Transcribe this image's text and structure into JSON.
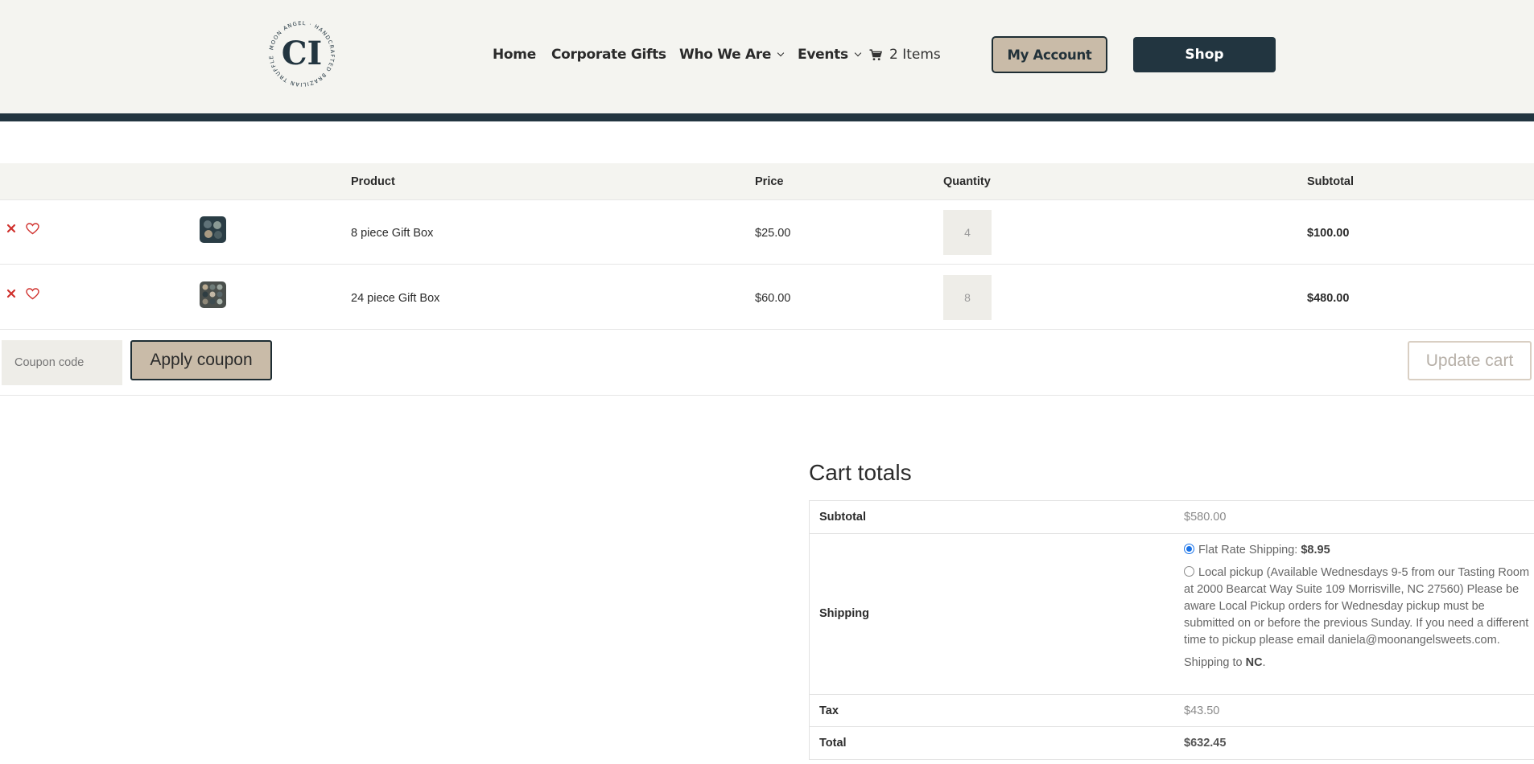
{
  "header": {
    "logo_text": "MOON ANGEL · HANDCRAFTED BRAZILIAN TRUFFLES ·",
    "logo_monogram": "CI",
    "nav": [
      {
        "label": "Home"
      },
      {
        "label": "Corporate Gifts"
      },
      {
        "label": "Who We Are",
        "dropdown": true
      },
      {
        "label": "Events",
        "dropdown": true
      }
    ],
    "cart_label": "2 Items",
    "account_label": "My Account",
    "shop_label": "Shop"
  },
  "cart": {
    "columns": {
      "product": "Product",
      "price": "Price",
      "quantity": "Quantity",
      "subtotal": "Subtotal"
    },
    "items": [
      {
        "name": "8 piece Gift Box",
        "price": "$25.00",
        "quantity": "4",
        "subtotal": "$100.00"
      },
      {
        "name": "24 piece Gift Box",
        "price": "$60.00",
        "quantity": "8",
        "subtotal": "$480.00"
      }
    ],
    "coupon_placeholder": "Coupon code",
    "apply_label": "Apply coupon",
    "update_label": "Update cart"
  },
  "totals": {
    "title": "Cart totals",
    "subtotal_label": "Subtotal",
    "subtotal_value": "$580.00",
    "shipping_label": "Shipping",
    "flat_rate_label": "Flat Rate Shipping:",
    "flat_rate_price": "$8.95",
    "local_pickup_text": "Local pickup (Available Wednesdays 9-5 from our Tasting Room at 2000 Bearcat Way Suite 109 Morrisville, NC 27560) Please be aware Local Pickup orders for Wednesday pickup must be submitted on or before the previous Sunday. If you need a different time to pickup please email daniela@moonangelsweets.com.",
    "shipping_to_prefix": "Shipping to",
    "shipping_to_state": "NC",
    "tax_label": "Tax",
    "tax_value": "$43.50",
    "total_label": "Total",
    "total_value": "$632.45"
  },
  "colors": {
    "header_bg": "#f4f4f0",
    "brand_dark": "#223540",
    "accent_tan": "#c9bba8",
    "remove_red": "#d0312d"
  }
}
